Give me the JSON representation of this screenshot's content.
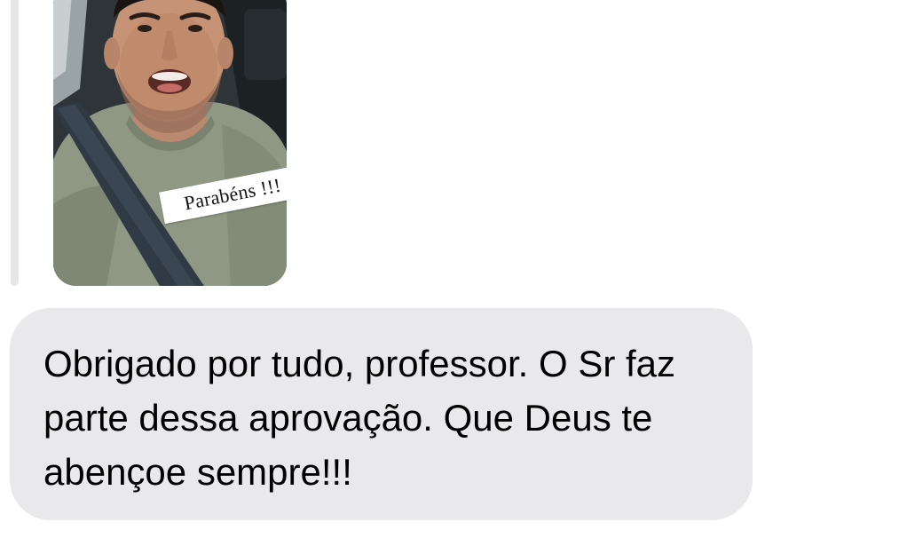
{
  "story_reply": {
    "sticker_text": "Parabéns !!!",
    "colors": {
      "sticker_background": "#ffffff",
      "reply_bar": "#e6e6e8"
    }
  },
  "message": {
    "text": "Obrigado por tudo, professor. O Sr faz parte dessa aprovação. Que Deus te abençoe sempre!!!",
    "colors": {
      "bubble_background": "#e9e9eb",
      "text": "#000000"
    }
  }
}
